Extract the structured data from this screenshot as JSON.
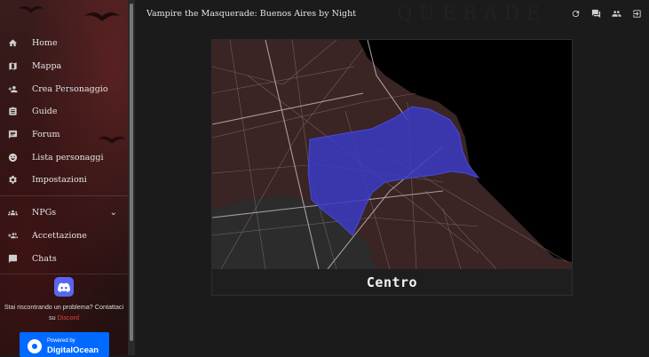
{
  "app": {
    "title": "Vampire the Masquerade: Buenos Aires by Night",
    "wordmark": "QUERADE"
  },
  "header": {
    "icons": [
      "refresh-icon",
      "chat-icon",
      "users-icon",
      "login-icon"
    ]
  },
  "sidebar": {
    "items": [
      {
        "label": "Home",
        "icon": "home-icon"
      },
      {
        "label": "Mappa",
        "icon": "map-icon"
      },
      {
        "label": "Crea Personaggio",
        "icon": "add-person-icon"
      },
      {
        "label": "Guide",
        "icon": "clipboard-icon"
      },
      {
        "label": "Forum",
        "icon": "forum-icon"
      },
      {
        "label": "Lista personaggi",
        "icon": "face-icon"
      },
      {
        "label": "Impostazioni",
        "icon": "gear-icon"
      }
    ],
    "secondary": [
      {
        "label": "NPGs",
        "icon": "group-icon",
        "expandable": true
      },
      {
        "label": "Accettazione",
        "icon": "group-add-icon"
      },
      {
        "label": "Chats",
        "icon": "chat-bubble-icon"
      }
    ],
    "support": {
      "text": "Stai riscontrando un problema? Contattaci su",
      "link": "Discord"
    },
    "sponsor": {
      "powered": "Powered by",
      "name": "DigitalOcean"
    }
  },
  "map": {
    "caption": "Centro",
    "colors": {
      "land": "#3a2424",
      "water": "#000000",
      "highlight": "#3b3bc4",
      "grey": "#2b2b2b"
    }
  }
}
